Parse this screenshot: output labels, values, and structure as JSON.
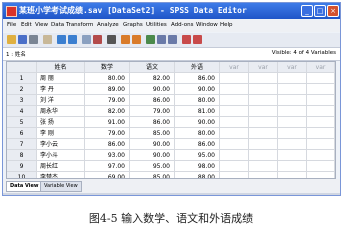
{
  "window": {
    "title": "某班小学考试成绩.sav [DataSet2] - SPSS Data Editor",
    "controls": [
      "_",
      "□",
      "×"
    ]
  },
  "menu": [
    "File",
    "Edit",
    "View",
    "Data",
    "Transform",
    "Analyze",
    "Graphs",
    "Utilities",
    "Add-ons",
    "Window",
    "Help"
  ],
  "toolbar": {
    "icons": [
      "open-icon",
      "save-icon",
      "print-icon",
      "recall-dialog-icon",
      "undo-icon",
      "redo-icon",
      "goto-case-icon",
      "variables-icon",
      "find-icon",
      "insert-case-icon",
      "insert-variable-icon",
      "split-file-icon",
      "weight-cases-icon",
      "select-cases-icon",
      "value-labels-icon",
      "use-sets-icon"
    ]
  },
  "cell_editor": {
    "cell_ref": "1 : 姓名",
    "cell_value": "",
    "visible_text": "Visible: 4 of 4 Variables"
  },
  "grid": {
    "columns": [
      "姓名",
      "数学",
      "语文",
      "外语",
      "var",
      "var",
      "var",
      "var"
    ],
    "rows": [
      {
        "n": "1",
        "name": "周  丽",
        "math": "80.00",
        "chinese": "82.00",
        "english": "86.00"
      },
      {
        "n": "2",
        "name": "李  丹",
        "math": "89.00",
        "chinese": "90.00",
        "english": "90.00"
      },
      {
        "n": "3",
        "name": "刘  洋",
        "math": "79.00",
        "chinese": "86.00",
        "english": "80.00"
      },
      {
        "n": "4",
        "name": "周永华",
        "math": "82.00",
        "chinese": "79.00",
        "english": "81.00"
      },
      {
        "n": "5",
        "name": "张  扬",
        "math": "91.00",
        "chinese": "86.00",
        "english": "90.00"
      },
      {
        "n": "6",
        "name": "李  刚",
        "math": "79.00",
        "chinese": "85.00",
        "english": "80.00"
      },
      {
        "n": "7",
        "name": "李小云",
        "math": "86.00",
        "chinese": "90.00",
        "english": "86.00"
      },
      {
        "n": "8",
        "name": "李小斗",
        "math": "93.00",
        "chinese": "90.00",
        "english": "95.00"
      },
      {
        "n": "9",
        "name": "周长红",
        "math": "97.00",
        "chinese": "95.00",
        "english": "98.00"
      },
      {
        "n": "10",
        "name": "李楚杰",
        "math": "69.00",
        "chinese": "85.00",
        "english": "88.00"
      }
    ]
  },
  "tabs": [
    {
      "label": "Data View",
      "active": true
    },
    {
      "label": "Variable View",
      "active": false
    }
  ],
  "caption": "图4-5    输入数学、语文和外语成绩"
}
